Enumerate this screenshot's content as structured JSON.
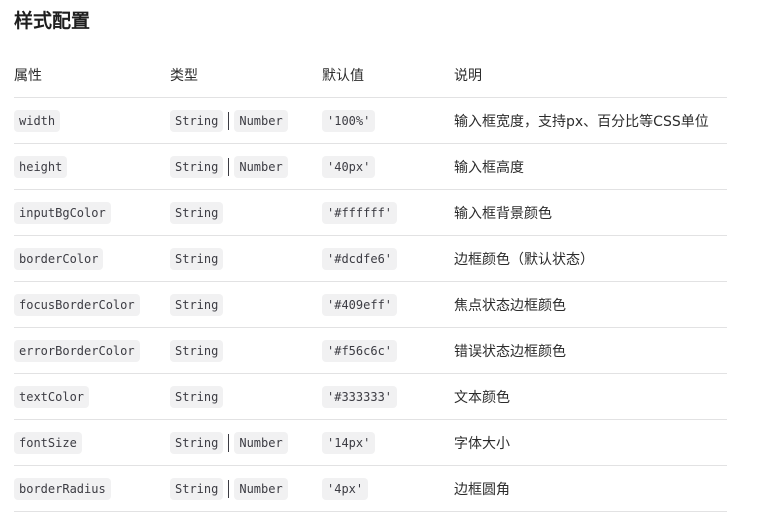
{
  "heading": "样式配置",
  "columns": [
    "属性",
    "类型",
    "默认值",
    "说明"
  ],
  "rows": [
    {
      "name": "width",
      "types": [
        "String",
        "Number"
      ],
      "default": "'100%'",
      "desc": "输入框宽度，支持px、百分比等CSS单位"
    },
    {
      "name": "height",
      "types": [
        "String",
        "Number"
      ],
      "default": "'40px'",
      "desc": "输入框高度"
    },
    {
      "name": "inputBgColor",
      "types": [
        "String"
      ],
      "default": "'#ffffff'",
      "desc": "输入框背景颜色"
    },
    {
      "name": "borderColor",
      "types": [
        "String"
      ],
      "default": "'#dcdfe6'",
      "desc": "边框颜色（默认状态）"
    },
    {
      "name": "focusBorderColor",
      "types": [
        "String"
      ],
      "default": "'#409eff'",
      "desc": "焦点状态边框颜色"
    },
    {
      "name": "errorBorderColor",
      "types": [
        "String"
      ],
      "default": "'#f56c6c'",
      "desc": "错误状态边框颜色"
    },
    {
      "name": "textColor",
      "types": [
        "String"
      ],
      "default": "'#333333'",
      "desc": "文本颜色"
    },
    {
      "name": "fontSize",
      "types": [
        "String",
        "Number"
      ],
      "default": "'14px'",
      "desc": "字体大小"
    },
    {
      "name": "borderRadius",
      "types": [
        "String",
        "Number"
      ],
      "default": "'4px'",
      "desc": "边框圆角"
    }
  ]
}
